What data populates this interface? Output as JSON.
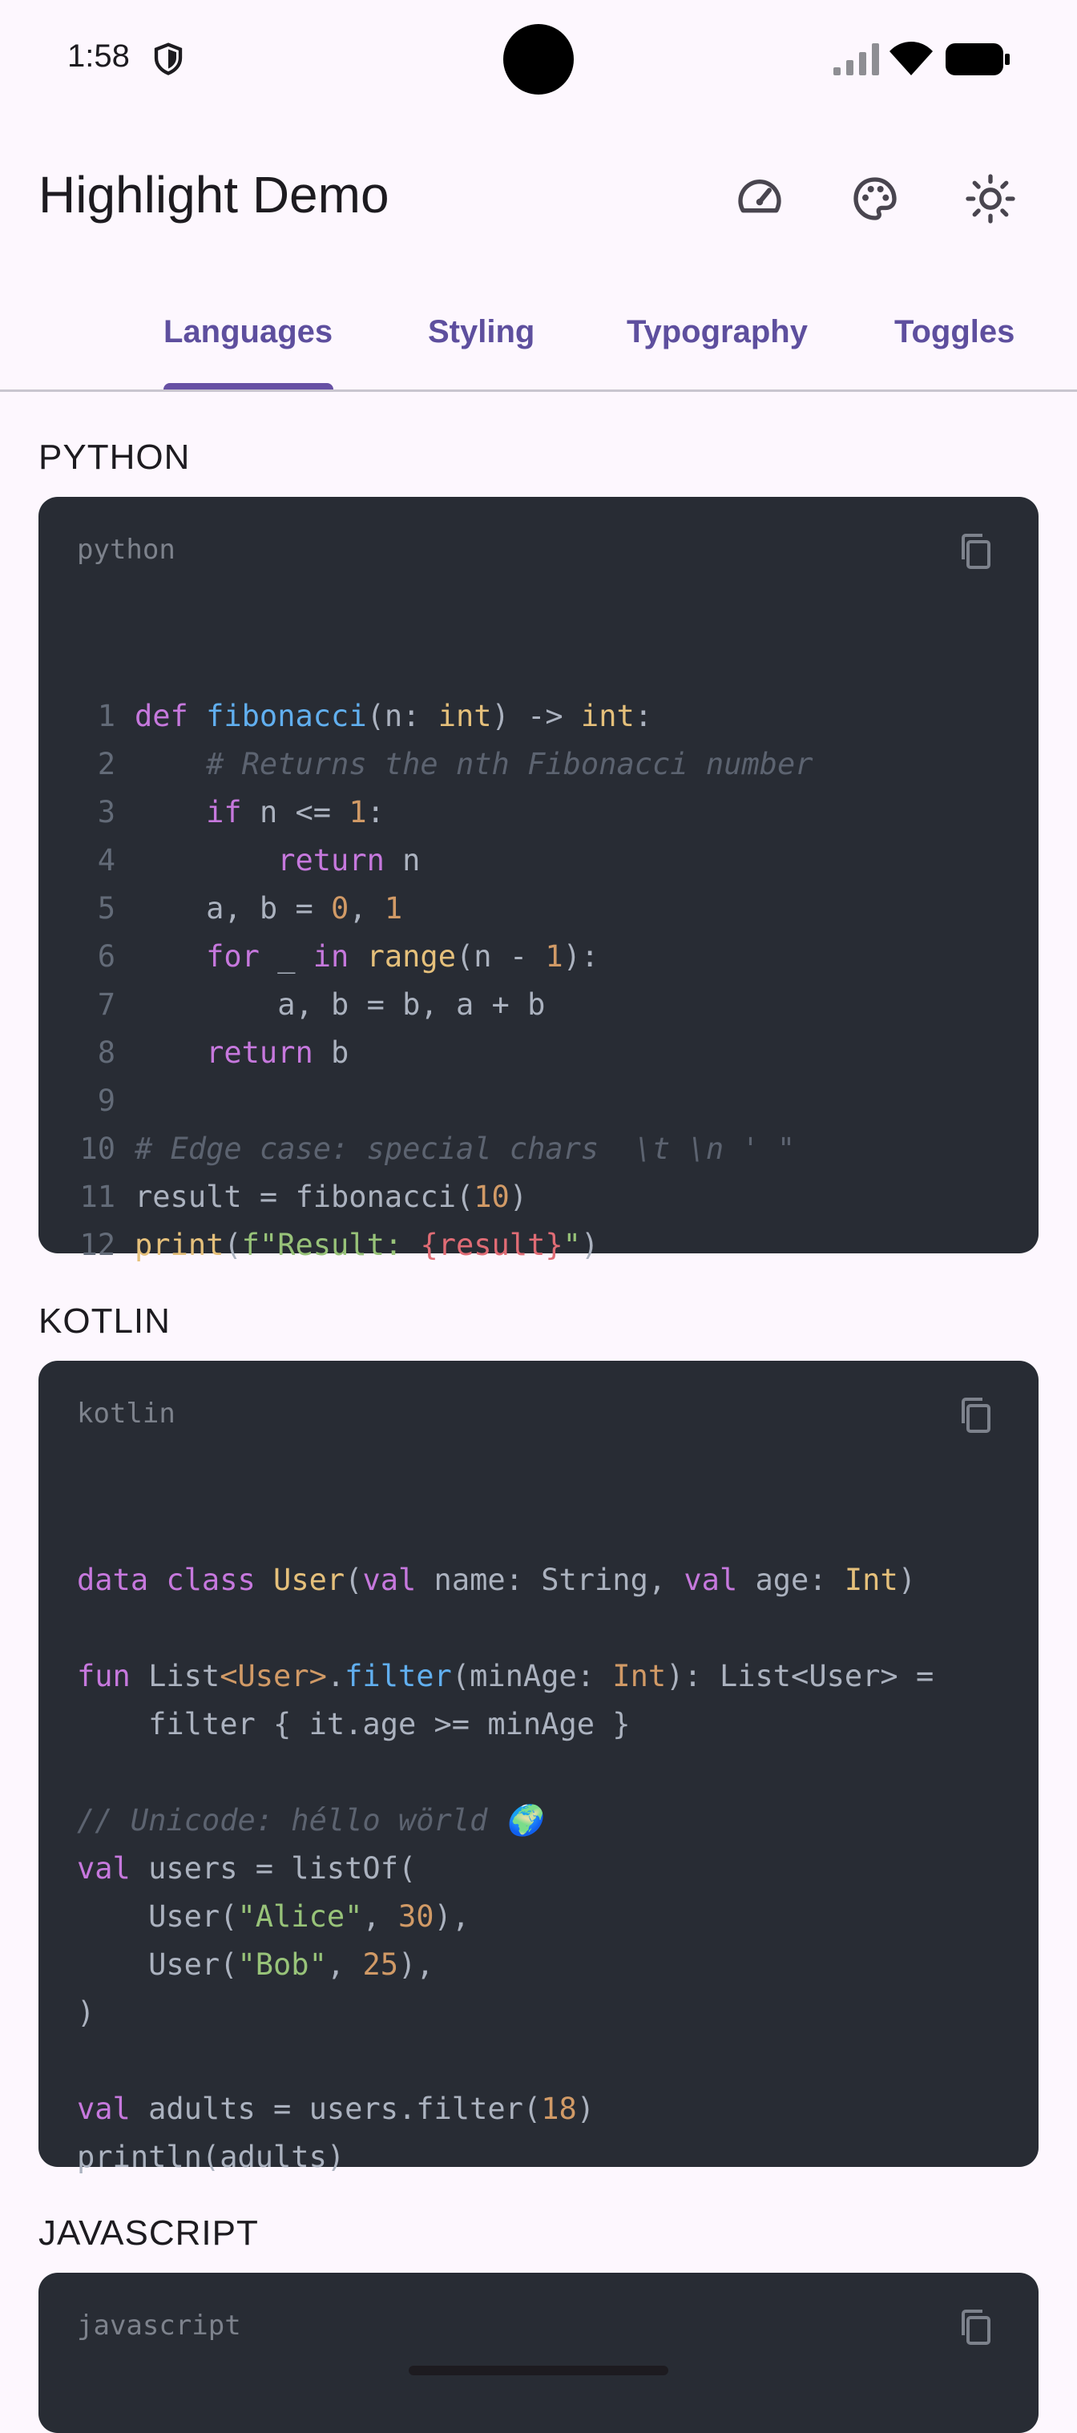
{
  "status_bar": {
    "time": "1:58"
  },
  "app_bar": {
    "title": "Highlight Demo"
  },
  "tabs": [
    "Languages",
    "Styling",
    "Typography",
    "Toggles"
  ],
  "sections": [
    {
      "title": "PYTHON",
      "language": "python"
    },
    {
      "title": "KOTLIN",
      "language": "kotlin"
    },
    {
      "title": "JAVASCRIPT",
      "language": "javascript"
    }
  ],
  "python_code": [
    "def fibonacci(n: int) -> int:",
    "    # Returns the nth Fibonacci number",
    "    if n <= 1:",
    "        return n",
    "    a, b = 0, 1",
    "    for _ in range(n - 1):",
    "        a, b = b, a + b",
    "    return b",
    "",
    "# Edge case: special chars  \\t \\n ' \"",
    "result = fibonacci(10)",
    "print(f\"Result: {result}\")"
  ],
  "kotlin_code": [
    "data class User(val name: String, val age: Int)",
    "",
    "fun List<User>.filter(minAge: Int): List<User> =",
    "    filter { it.age >= minAge }",
    "",
    "// Unicode: héllo wörld 🌍",
    "val users = listOf(",
    "    User(\"Alice\", 30),",
    "    User(\"Bob\", 25),",
    ")",
    "",
    "val adults = users.filter(18)",
    "println(adults)"
  ],
  "colors": {
    "code_bg": "#282c34",
    "accent": "#6750a4",
    "page_bg": "#fdf7fe"
  }
}
